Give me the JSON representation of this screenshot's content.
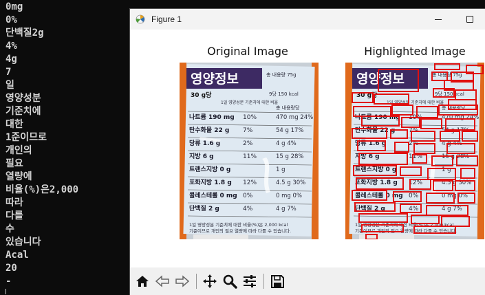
{
  "terminal": {
    "lines": [
      "0mg",
      "0%",
      "단백질2g",
      "4%",
      "4g",
      "7",
      "일",
      "영양성분",
      "기준치에",
      "대한",
      "1준이므로",
      "개인의",
      "필요",
      "열량에",
      "비율(%)은2,000",
      "따라",
      "다를",
      "수",
      "있습니다",
      "Acal",
      "20",
      "-"
    ]
  },
  "figure": {
    "window_title": "Figure 1",
    "left_title": "Original Image",
    "right_title": "Highlighted Image",
    "label": {
      "heading": "영양정보",
      "serving": "30 g당",
      "total_hint": "총 내용량 75g",
      "calories_hint": "9당 150 kcal",
      "col_daily": "1일 영양성분 기준치에 대한 비율",
      "col_total": "총 내용량당",
      "rows": [
        {
          "name": "나트륨 190 mg",
          "pct": "10%",
          "total": "470 mg 24%"
        },
        {
          "name": "탄수화물 22 g",
          "pct": "7%",
          "total": "54 g 17%"
        },
        {
          "name": "당류 1.6 g",
          "pct": "2%",
          "total": "4 g 4%"
        },
        {
          "name": "지방 6 g",
          "pct": "11%",
          "total": "15 g 28%"
        },
        {
          "name": "트랜스지방 0 g",
          "pct": "",
          "total": "1 g"
        },
        {
          "name": "포화지방 1.8 g",
          "pct": "12%",
          "total": "4.5 g 30%"
        },
        {
          "name": "콜레스테롤 0 mg",
          "pct": "0%",
          "total": "0 mg 0%"
        },
        {
          "name": "단백질 2 g",
          "pct": "4%",
          "total": "4 g 7%"
        }
      ],
      "footer": "1일 영양성분 기준치에 대한 비율(%)은 2,000 kcal 기준이므로 개인의 필요 열량에 따라 다를 수 있습니다."
    }
  },
  "toolbar": {
    "buttons": [
      "home-icon",
      "back-icon",
      "forward-icon",
      "pan-icon",
      "zoom-icon",
      "configure-icon",
      "save-icon"
    ]
  },
  "colors": {
    "highlight": "#e01010",
    "label_blue": "#3d2a63",
    "label_bg": "#dfe9f2",
    "label_orange": "#e06a1c"
  }
}
